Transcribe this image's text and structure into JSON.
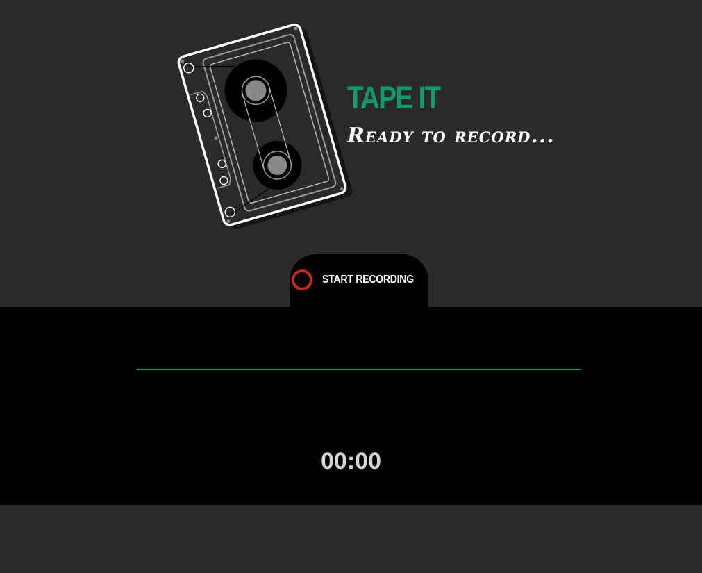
{
  "app": {
    "title": "TAPE IT",
    "status": "Ready to record..."
  },
  "controls": {
    "record_label": "START RECORDING"
  },
  "recorder": {
    "timer": "00:00"
  },
  "colors": {
    "background": "#2a2a2a",
    "panel": "#000000",
    "accent": "#0f9a6e",
    "record": "#c42a1e",
    "waveform": "#1e9560"
  },
  "icons": {
    "logo": "cassette-tape-icon",
    "record": "record-circle-icon"
  }
}
